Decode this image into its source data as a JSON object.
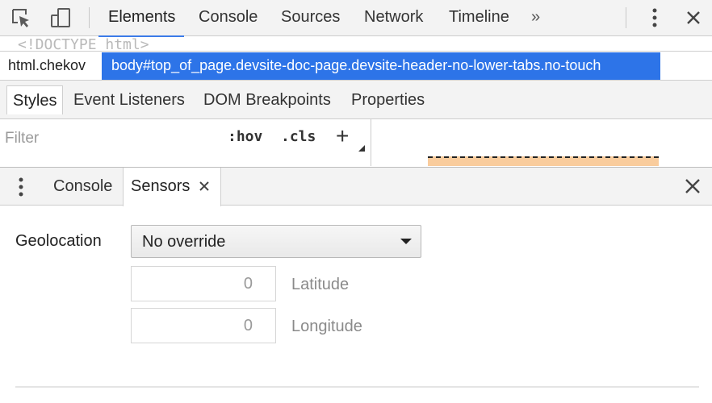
{
  "toolbar": {
    "tabs": [
      "Elements",
      "Console",
      "Sources",
      "Network",
      "Timeline"
    ],
    "overflow_glyph": "»",
    "icons": [
      "inspect-element-icon",
      "device-toggle-icon",
      "more-menu-icon",
      "close-icon"
    ]
  },
  "dom": {
    "doctype_line": "<!DOCTYPE html>",
    "breadcrumbs": [
      "html.chekov",
      "body#top_of_page.devsite-doc-page.devsite-header-no-lower-tabs.no-touch"
    ]
  },
  "styles": {
    "subtabs": [
      "Styles",
      "Event Listeners",
      "DOM Breakpoints",
      "Properties"
    ],
    "filter_placeholder": "Filter",
    "hov": ":hov",
    "cls": ".cls",
    "add_rule": "+"
  },
  "drawer": {
    "tabs": [
      "Console",
      "Sensors"
    ],
    "selected_tab": "Sensors"
  },
  "sensors": {
    "geolocation_label": "Geolocation",
    "geolocation_value": "No override",
    "latitude_value": "0",
    "latitude_label": "Latitude",
    "longitude_value": "0",
    "longitude_label": "Longitude"
  },
  "colors": {
    "accent": "#2d74e8",
    "toolbar_bg": "#f3f3f3",
    "box_model_margin": "#f9cc9d"
  }
}
